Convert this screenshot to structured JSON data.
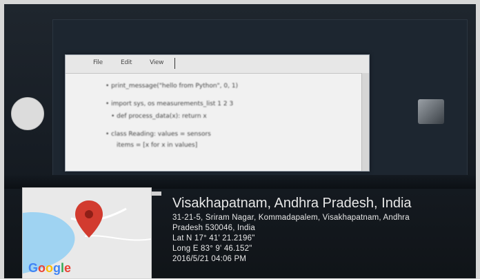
{
  "toolbar": {
    "menu_items": [
      "File",
      "Edit",
      "View"
    ]
  },
  "editor": {
    "lines": [
      "• print_message(\"hello from Python\", 0, 1)",
      "• import sys, os  measurements_list  1  2  3",
      "  • def process_data(x): return x",
      "• class Reading: values = sensors",
      "    items = [x for x in values]"
    ]
  },
  "location": {
    "title": "Visakhapatnam, Andhra Pradesh, India",
    "address_line1": "31-21-5, Sriram Nagar, Kommadapalem, Visakhapatnam, Andhra",
    "address_line2": "Pradesh 530046, India",
    "lat": "Lat N 17° 41' 21.2196\"",
    "long": "Long E 83° 9' 46.152\"",
    "datetime": "2016/5/21 04:06 PM"
  },
  "map": {
    "brand": "Google",
    "pin_color": "#d23b2f",
    "water_color": "#9fd3f2",
    "land_color": "#e9e9e9"
  },
  "colors": {
    "background": "#1b2229",
    "overlay_text": "#e8e8e8"
  }
}
